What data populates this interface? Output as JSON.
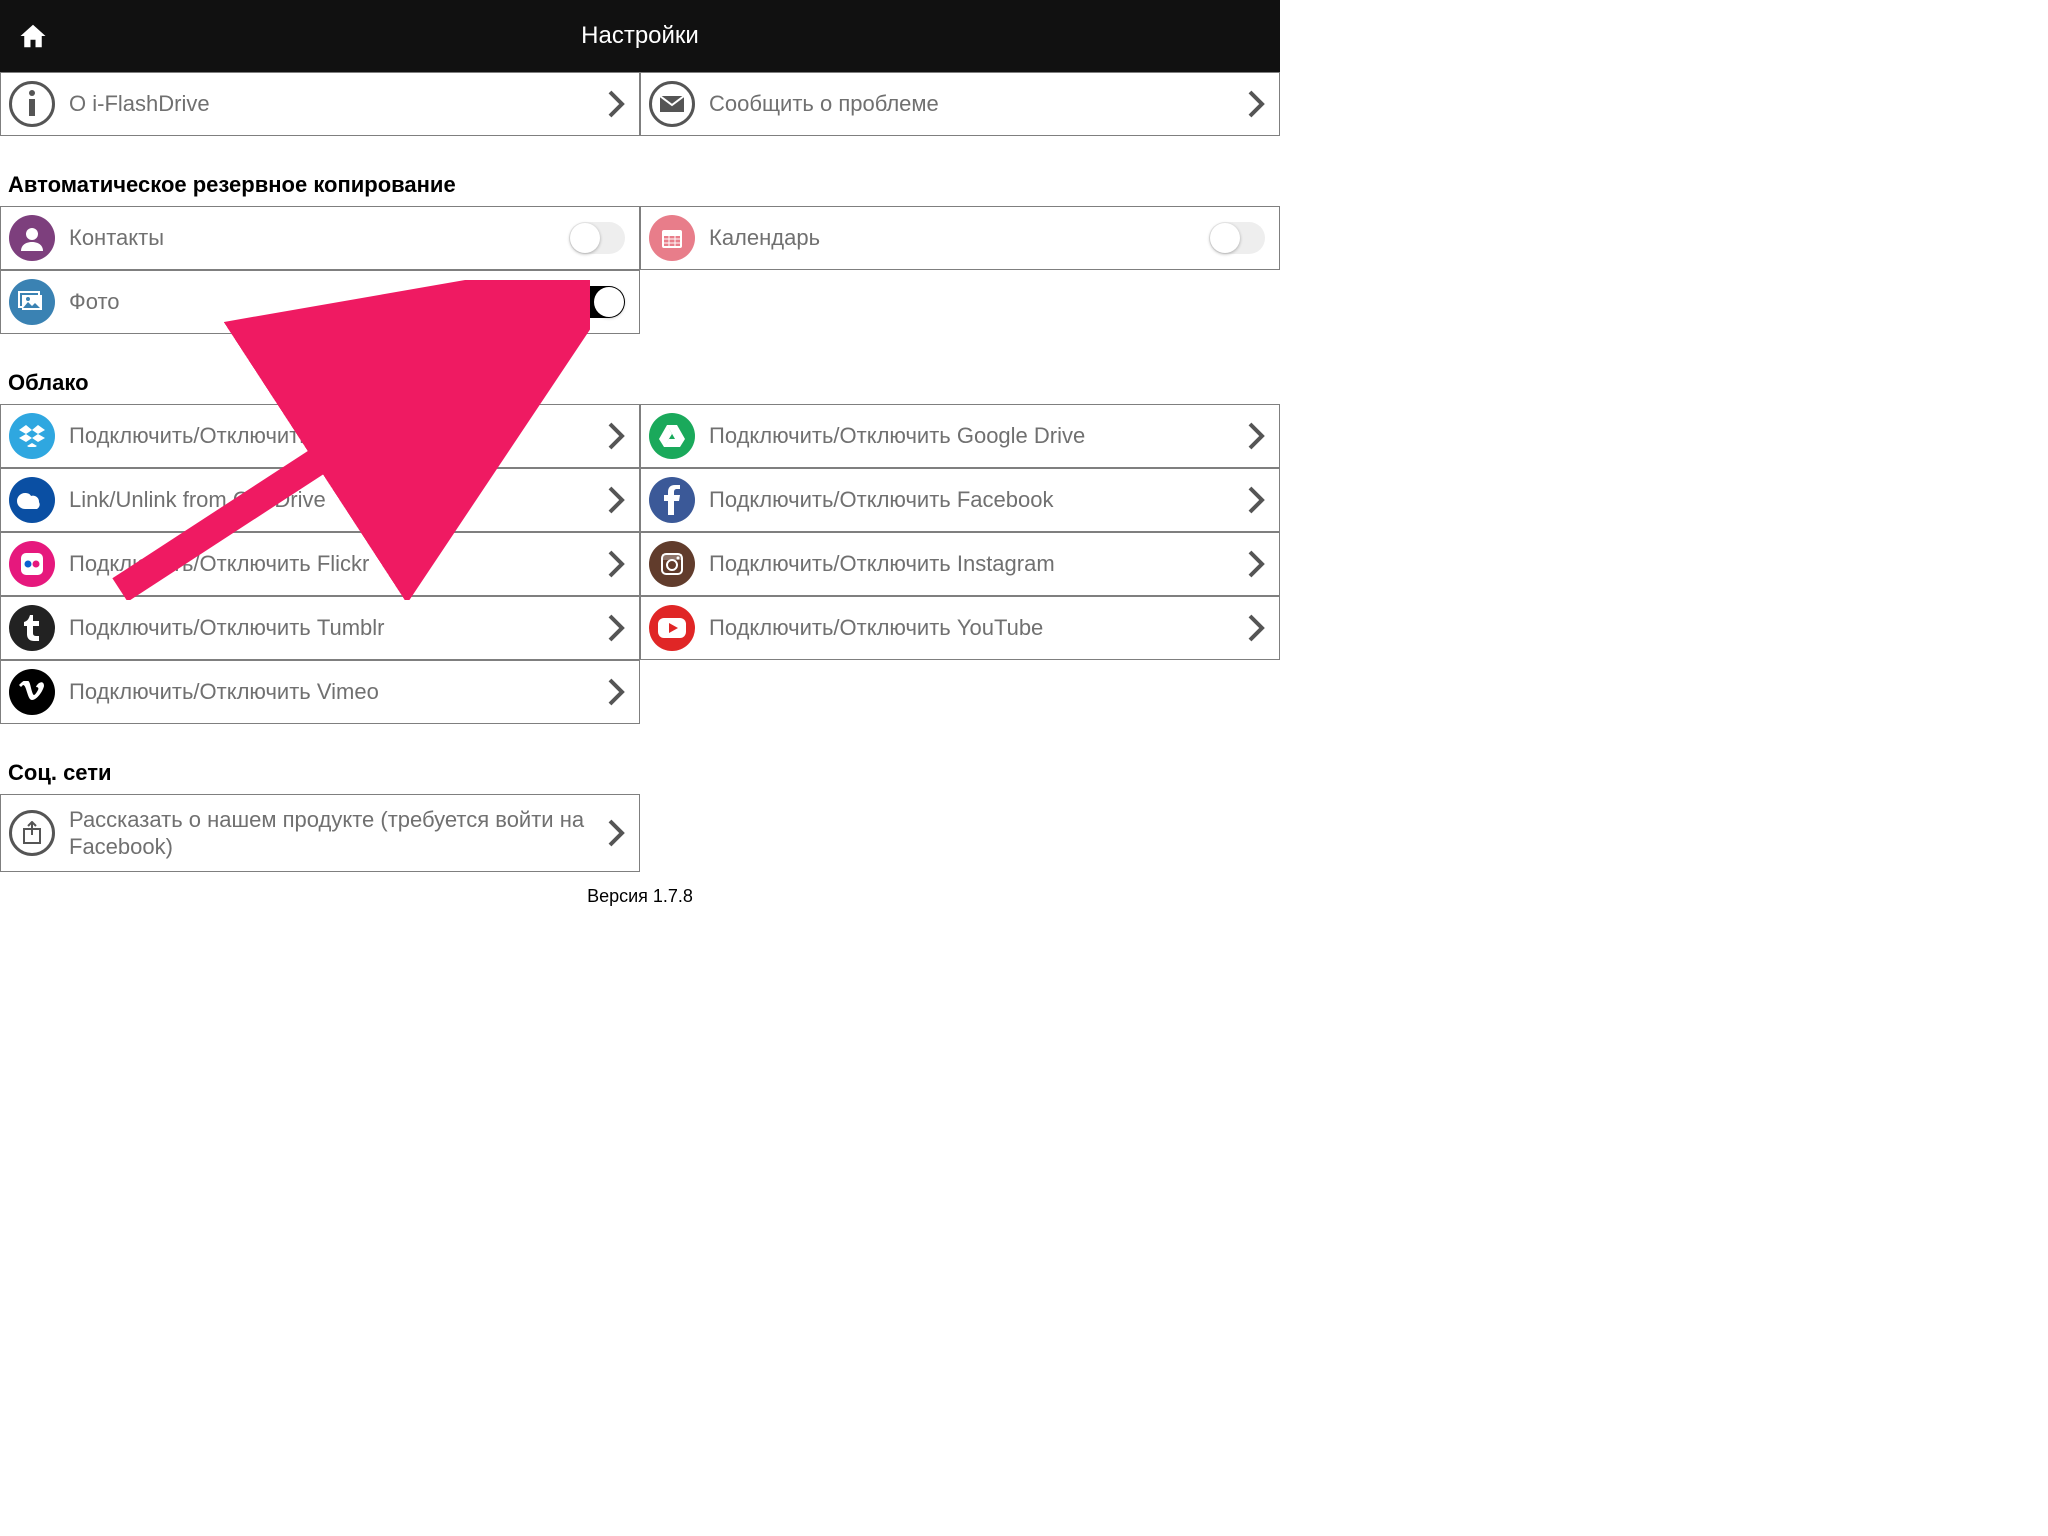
{
  "header": {
    "title": "Настройки"
  },
  "top": {
    "about": "О i-FlashDrive",
    "report": "Сообщить о проблеме"
  },
  "backup": {
    "heading": "Автоматическое резервное копирование",
    "contacts": "Контакты",
    "calendar": "Календарь",
    "photos": "Фото"
  },
  "cloud": {
    "heading": "Облако",
    "dropbox": "Подключить/Отключить Dropbox",
    "gdrive": "Подключить/Отключить Google Drive",
    "onedrive": "Link/Unlink from OneDrive",
    "facebook": "Подключить/Отключить Facebook",
    "flickr": "Подключить/Отключить  Flickr",
    "instagram": "Подключить/Отключить Instagram",
    "tumblr": "Подключить/Отключить Tumblr",
    "youtube": "Подключить/Отключить YouTube",
    "vimeo": "Подключить/Отключить Vimeo"
  },
  "social": {
    "heading": "Соц. сети",
    "share": "Рассказать о нашем продукте (требуется войти на Facebook)"
  },
  "version": "Версия 1.7.8",
  "colors": {
    "contacts": "#7d3f7d",
    "calendar": "#e87d8a",
    "photos": "#3a82b3",
    "dropbox": "#2fa7e0",
    "gdrive": "#1aa95b",
    "onedrive": "#0a4fa3",
    "facebook": "#3b5998",
    "flickr": "#e6187d",
    "instagram": "#613c2c",
    "tumblr": "#222",
    "youtube": "#e02626",
    "vimeo": "#000"
  }
}
